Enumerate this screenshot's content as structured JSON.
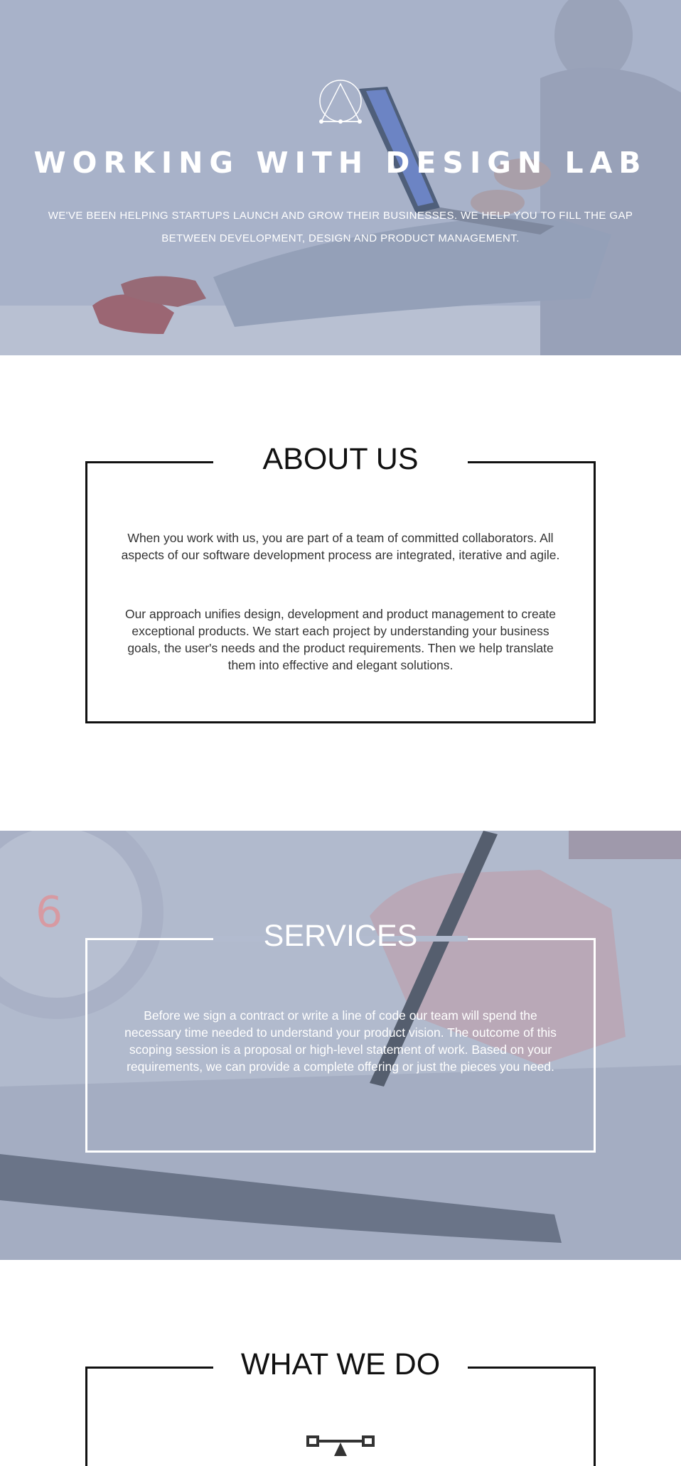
{
  "hero": {
    "title": "WORKING WITH DESIGN LAB",
    "subtitle": "WE'VE BEEN HELPING STARTUPS LAUNCH AND GROW THEIR BUSINESSES. WE HELP YOU TO FILL THE GAP BETWEEN DEVELOPMENT, DESIGN AND PRODUCT MANAGEMENT.",
    "logo_icon": "triangle-circle-logo-icon",
    "background_image": "man-with-laptop-photo"
  },
  "about": {
    "heading": "ABOUT US",
    "paragraphs": [
      "When you work with us, you are part of a team of committed collaborators. All aspects of our software development process are integrated, iterative and agile.",
      "Our approach unifies design, development and product management to create exceptional products. We start each project by understanding your business goals, the user's needs and the product requirements. Then we help translate them into effective and elegant solutions."
    ]
  },
  "services": {
    "heading": "SERVICES",
    "paragraph": "Before we sign a contract or write a line of code our team will spend the necessary time needed to understand your product vision. The outcome of this scoping session is a proposal or high-level statement of work. Based on your requirements, we can provide a complete offering or just the pieces you need.",
    "background_image": "hand-with-stylus-photo"
  },
  "what_we_do": {
    "heading": "WHAT WE DO",
    "icon": "vector-pen-tool-icon"
  },
  "colors": {
    "hero_overlay": "#a9b4ca",
    "frame_dark": "#111111",
    "frame_light": "#ffffff"
  }
}
